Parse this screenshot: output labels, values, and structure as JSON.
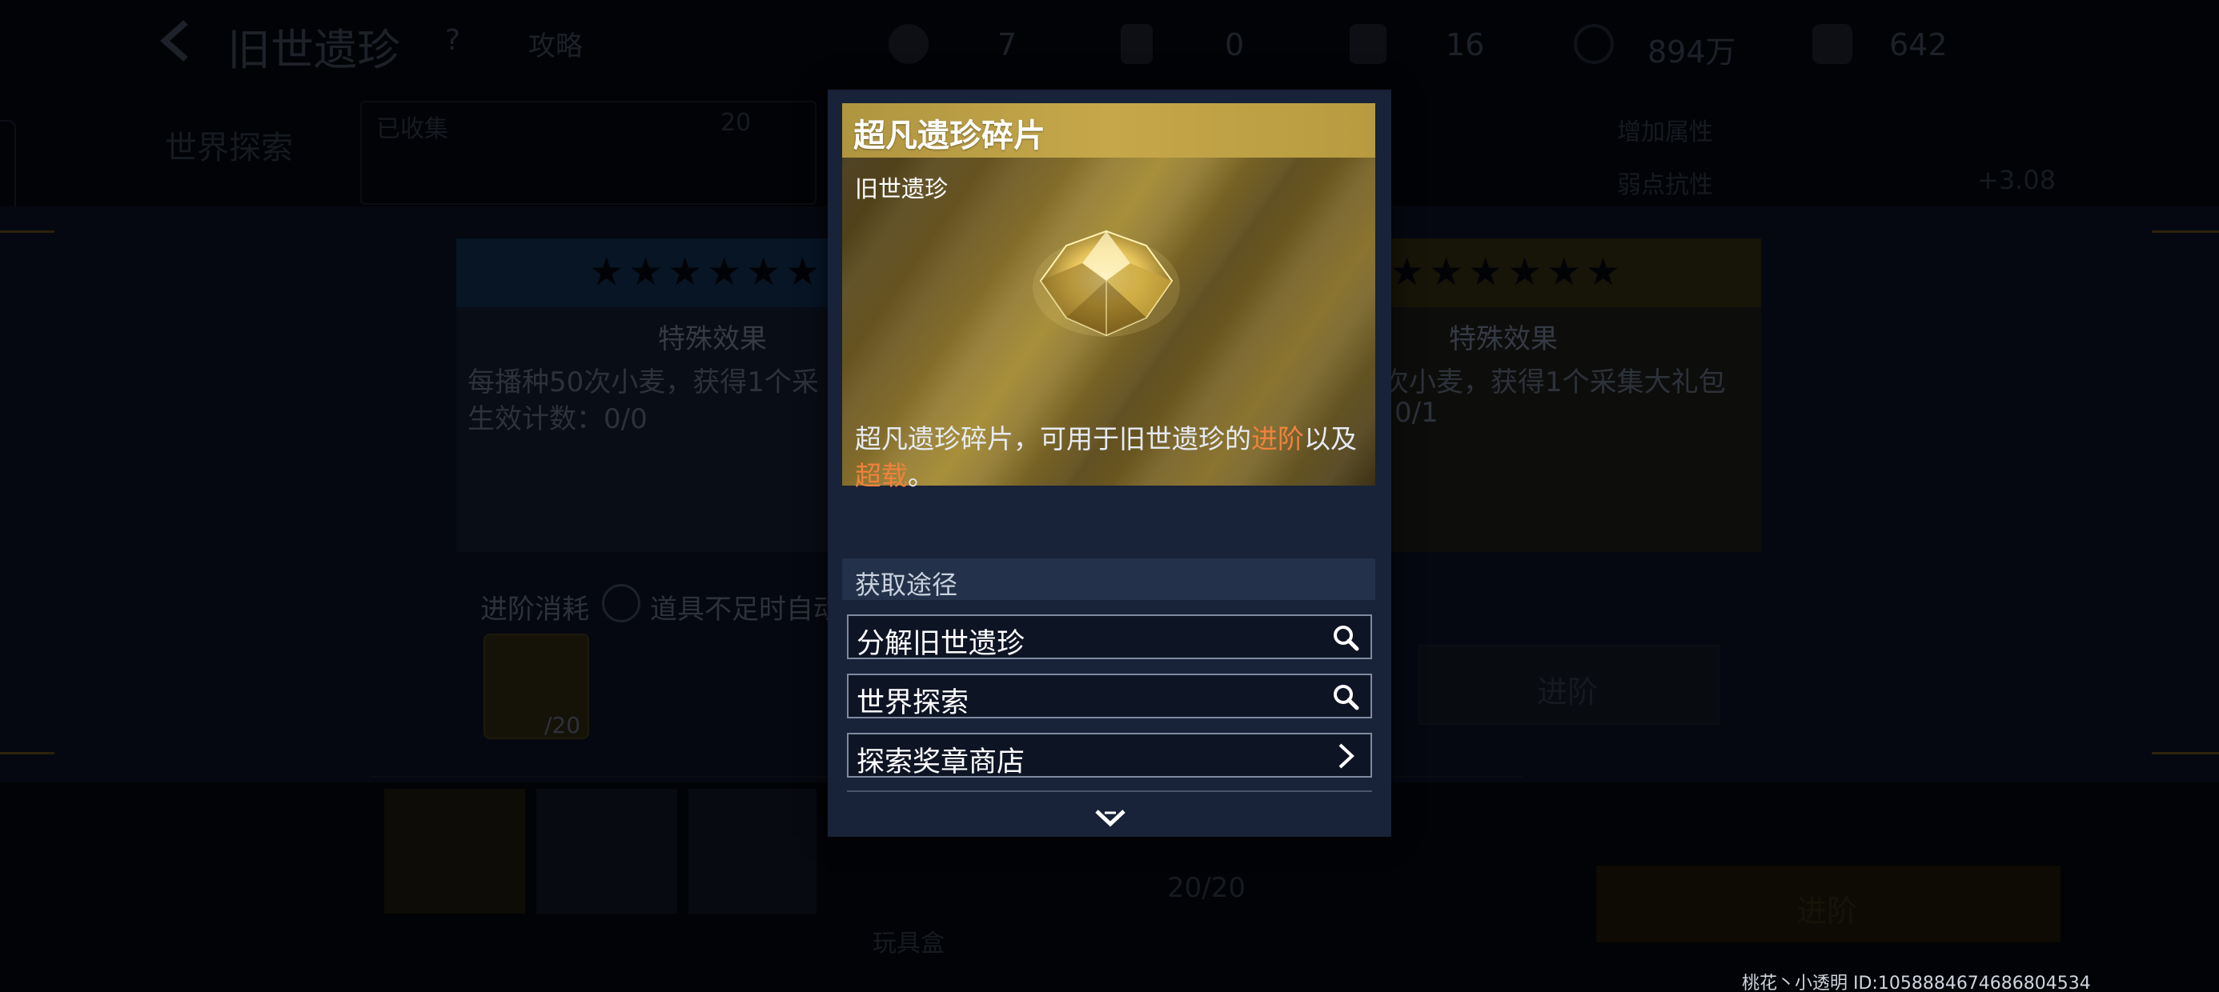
{
  "colors": {
    "accent_orange": "#f0823c",
    "title_gold": "#c6a84a",
    "modal_bg": "#182238"
  },
  "topbar": {
    "back_icon": "chevron-left-icon",
    "title": "旧世遗珍",
    "help_label": "?",
    "guide_label": "攻略",
    "currencies": [
      {
        "icon": "currency-1-icon",
        "value": "7"
      },
      {
        "icon": "currency-2-icon",
        "value": "0"
      },
      {
        "icon": "currency-3-icon",
        "value": "16"
      },
      {
        "icon": "coin-icon",
        "value": "894万"
      },
      {
        "icon": "gem-icon",
        "value": "642"
      }
    ]
  },
  "background": {
    "collection_tab": "世界探索",
    "collected_label": "已收集",
    "collected_count": "20",
    "attr_labels": [
      "增加属性",
      "弱点抗性"
    ],
    "attr_value": "+3.08",
    "effect_title": "特殊效果",
    "effect_text_left": "每播种50次小麦，获得1个采",
    "effect_count_left": "生效计数：0/0",
    "effect_text_right": "次小麦，获得1个采集大礼包",
    "effect_count_right": "0/1",
    "advance_cost_label": "进阶消耗",
    "auto_label": "道具不足时自动",
    "item_count": "/20",
    "advance_button": "进阶",
    "advance_button_bottom": "进阶",
    "toy_box_label": "玩具盒",
    "slot_count": "20/20"
  },
  "modal": {
    "title": "超凡遗珍碎片",
    "category": "旧世遗珍",
    "desc_part1": "超凡遗珍碎片，可用于旧世遗珍的",
    "desc_hl1": "进阶",
    "desc_part2": "以及",
    "desc_hl2": "超载",
    "desc_part3": "。",
    "source_title": "获取途径",
    "sources": [
      {
        "label": "分解旧世遗珍",
        "icon": "search-icon"
      },
      {
        "label": "世界探索",
        "icon": "search-icon"
      },
      {
        "label": "探索奖章商店",
        "icon": "chevron-right-icon"
      }
    ],
    "more_icon": "chevron-down-icon"
  },
  "footer": {
    "player_id": "桃花丶小透明  ID:1058884674686804534"
  }
}
